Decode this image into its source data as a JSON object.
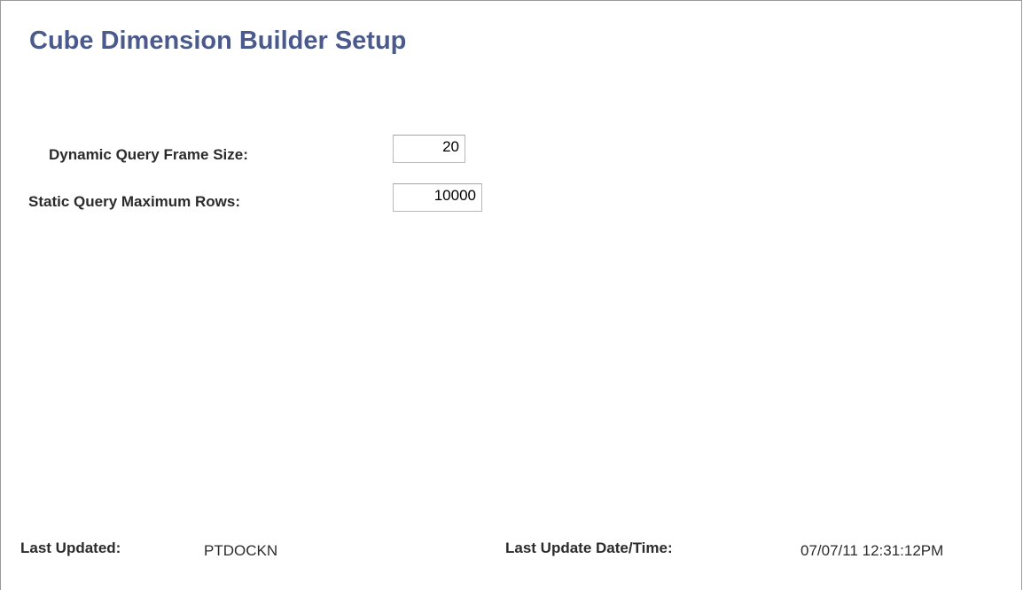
{
  "page": {
    "title": "Cube Dimension Builder Setup"
  },
  "form": {
    "dynamic_query_frame_size": {
      "label": "Dynamic Query Frame Size:",
      "value": "20"
    },
    "static_query_maximum_rows": {
      "label": "Static Query Maximum Rows:",
      "value": "10000"
    }
  },
  "footer": {
    "last_updated_label": "Last Updated:",
    "last_updated_value": "PTDOCKN",
    "last_update_datetime_label": "Last Update Date/Time:",
    "last_update_datetime_value": "07/07/11 12:31:12PM"
  },
  "colors": {
    "title": "#4b5a8c",
    "label": "#2b2b2b",
    "input_border": "#b9b9b9"
  }
}
